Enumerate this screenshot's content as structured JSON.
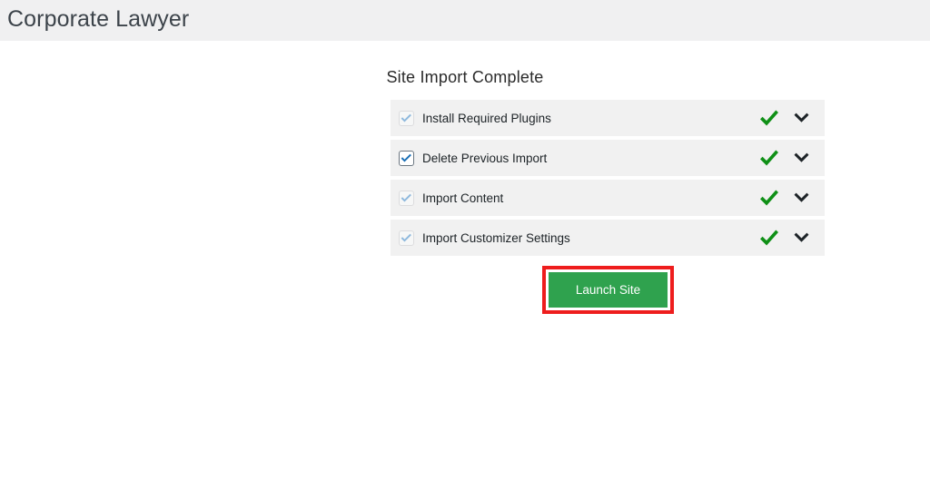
{
  "admin_bar": {
    "site_title": "Corporate Lawyer"
  },
  "main": {
    "heading": "Site Import Complete",
    "steps": [
      {
        "label": "Install Required Plugins",
        "checkbox_state": "checked-disabled",
        "status_icon": "green-check-icon",
        "toggle_icon": "chevron-down-icon"
      },
      {
        "label": "Delete Previous Import",
        "checkbox_state": "checked-enabled",
        "status_icon": "green-check-icon",
        "toggle_icon": "chevron-down-icon"
      },
      {
        "label": "Import Content",
        "checkbox_state": "checked-disabled",
        "status_icon": "green-check-icon",
        "toggle_icon": "chevron-down-icon"
      },
      {
        "label": "Import Customizer Settings",
        "checkbox_state": "checked-disabled",
        "status_icon": "green-check-icon",
        "toggle_icon": "chevron-down-icon"
      }
    ],
    "launch_button": {
      "label": "Launch Site",
      "background_color": "#2fa24e",
      "text_color": "#ffffff",
      "highlight_border_color": "#ee1d1d"
    }
  },
  "colors": {
    "admin_bar_background": "#f0f0f1",
    "row_background": "#f1f1f1",
    "page_background": "#ffffff",
    "success_green": "#0f9016",
    "checkbox_enabled_blue": "#1a6fb5",
    "checkbox_disabled_blue": "#8fb9dd"
  }
}
